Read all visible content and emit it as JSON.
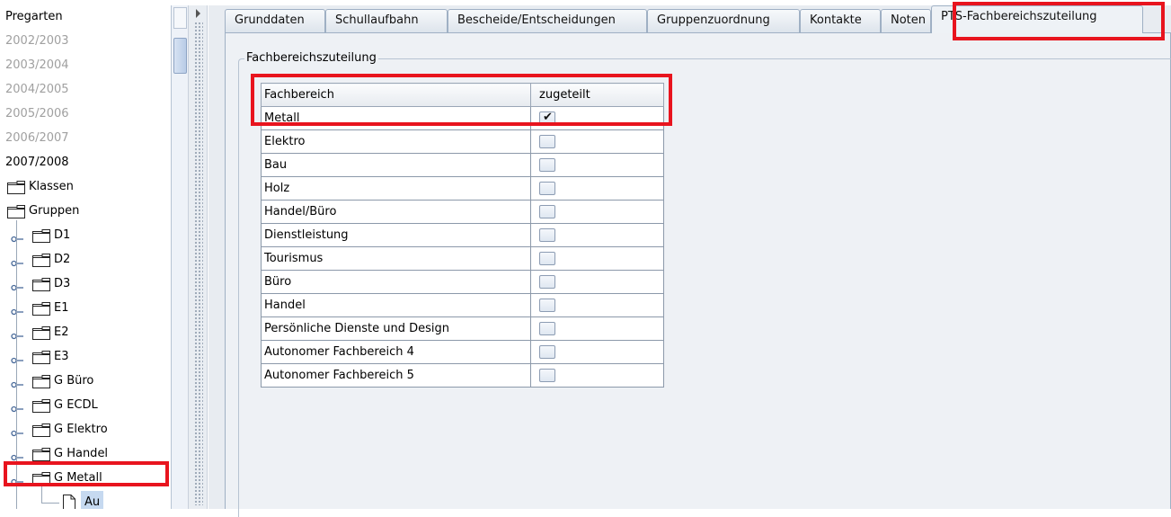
{
  "tree": {
    "items": [
      {
        "label": "Pregarten",
        "style": "normal"
      },
      {
        "label": "2002/2003",
        "style": "grey"
      },
      {
        "label": "2003/2004",
        "style": "grey"
      },
      {
        "label": "2004/2005",
        "style": "grey"
      },
      {
        "label": "2005/2006",
        "style": "grey"
      },
      {
        "label": "2006/2007",
        "style": "grey"
      },
      {
        "label": "2007/2008",
        "style": "normal"
      },
      {
        "label": "Klassen",
        "style": "folder"
      },
      {
        "label": "Gruppen",
        "style": "folder"
      }
    ],
    "groups": [
      "D1",
      "D2",
      "D3",
      "E1",
      "E2",
      "E3",
      "G Büro",
      "G ECDL",
      "G Elektro",
      "G Handel",
      "G Metall"
    ],
    "leaf": "Au"
  },
  "tabs": [
    "Grunddaten",
    "Schullaufbahn",
    "Bescheide/Entscheidungen",
    "Gruppenzuordnung",
    "Kontakte",
    "Noten",
    "PTS-Fachbereichszuteilung"
  ],
  "active_tab": "PTS-Fachbereichszuteilung",
  "group_title": "Fachbereichszuteilung",
  "table": {
    "headers": [
      "Fachbereich",
      "zugeteilt"
    ],
    "rows": [
      {
        "name": "Metall",
        "assigned": true
      },
      {
        "name": "Elektro",
        "assigned": false
      },
      {
        "name": "Bau",
        "assigned": false
      },
      {
        "name": "Holz",
        "assigned": false
      },
      {
        "name": "Handel/Büro",
        "assigned": false
      },
      {
        "name": "Dienstleistung",
        "assigned": false
      },
      {
        "name": "Tourismus",
        "assigned": false
      },
      {
        "name": "Büro",
        "assigned": false
      },
      {
        "name": "Handel",
        "assigned": false
      },
      {
        "name": "Persönliche Dienste und Design",
        "assigned": false
      },
      {
        "name": "Autonomer Fachbereich 4",
        "assigned": false
      },
      {
        "name": "Autonomer Fachbereich 5",
        "assigned": false
      }
    ]
  },
  "colors": {
    "highlight": "#e8141e",
    "grey_text": "#a0a0a0",
    "selection": "#c6d9f0"
  }
}
